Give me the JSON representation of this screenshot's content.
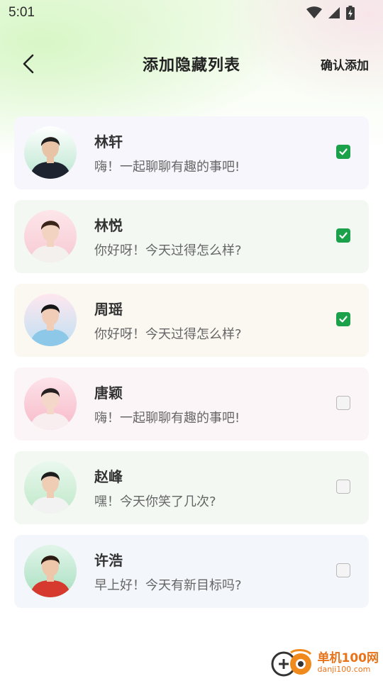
{
  "status_bar": {
    "time": "5:01"
  },
  "header": {
    "title": "添加隐藏列表",
    "confirm_label": "确认添加"
  },
  "contacts": [
    {
      "name": "林轩",
      "message": "嗨！一起聊聊有趣的事吧!",
      "checked": true,
      "card_color": "#f6f6fc",
      "avatar_bg": "#b9e6cf",
      "avatar_top": "#ffffff",
      "skin": "#e9c3a6",
      "hair": "#1f1f1f",
      "clothes": "#1e2330"
    },
    {
      "name": "林悦",
      "message": "你好呀！今天过得怎么样?",
      "checked": true,
      "card_color": "#f3f9f2",
      "avatar_bg": "#f7c9d2",
      "avatar_top": "#fde6ea",
      "skin": "#f2d3c2",
      "hair": "#3a2418",
      "clothes": "#f4f0ee"
    },
    {
      "name": "周瑶",
      "message": "你好呀！今天过得怎么样?",
      "checked": true,
      "card_color": "#fbf7f1",
      "avatar_bg": "#bfe0f3",
      "avatar_top": "#ffe7ef",
      "skin": "#f1cdb8",
      "hair": "#151515",
      "clothes": "#8ec8e8"
    },
    {
      "name": "唐颖",
      "message": "嗨！一起聊聊有趣的事吧!",
      "checked": false,
      "card_color": "#fcf5f8",
      "avatar_bg": "#f7b9c8",
      "avatar_top": "#fde3ea",
      "skin": "#f4d7c8",
      "hair": "#262020",
      "clothes": "#f8eef0"
    },
    {
      "name": "赵峰",
      "message": "嘿！今天你笑了几次?",
      "checked": false,
      "card_color": "#f3f9f2",
      "avatar_bg": "#bfe8c9",
      "avatar_top": "#eaf8ee",
      "skin": "#efcdb4",
      "hair": "#1d1d1d",
      "clothes": "#f2f2f2"
    },
    {
      "name": "许浩",
      "message": "早上好！今天有新目标吗?",
      "checked": false,
      "card_color": "#f3f7fb",
      "avatar_bg": "#a8dfc0",
      "avatar_top": "#e2f5ea",
      "skin": "#eec7aa",
      "hair": "#2a1a12",
      "clothes": "#d63a2f"
    }
  ],
  "watermark": {
    "site_name": "单机100网",
    "url": "danji100.com"
  },
  "colors": {
    "accent_green": "#1aa14a",
    "watermark_orange": "#e8731a"
  }
}
